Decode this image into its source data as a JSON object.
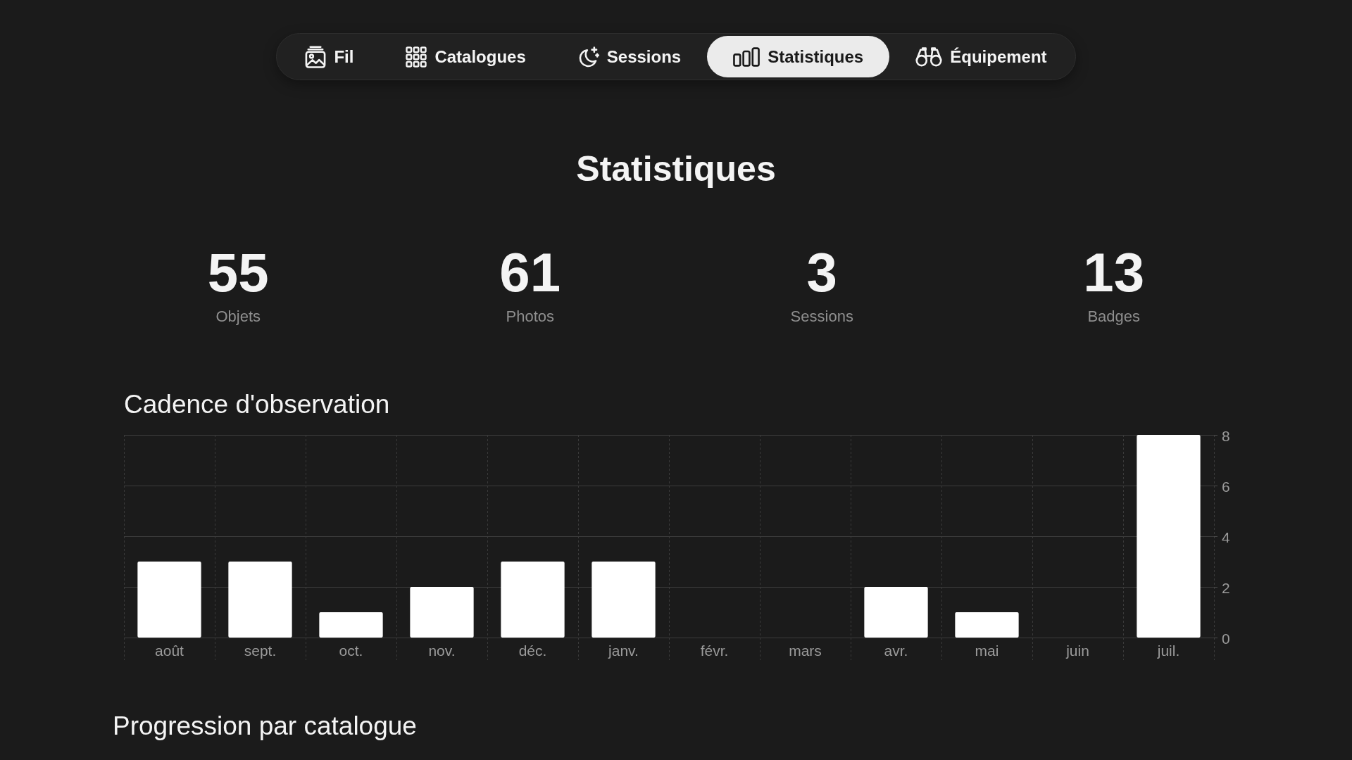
{
  "tabs": [
    {
      "label": "Fil",
      "selected": false
    },
    {
      "label": "Catalogues",
      "selected": false
    },
    {
      "label": "Sessions",
      "selected": false
    },
    {
      "label": "Statistiques",
      "selected": true
    },
    {
      "label": "Équipement",
      "selected": false
    }
  ],
  "page_title": "Statistiques",
  "stats": [
    {
      "value": "55",
      "label": "Objets"
    },
    {
      "value": "61",
      "label": "Photos"
    },
    {
      "value": "3",
      "label": "Sessions"
    },
    {
      "value": "13",
      "label": "Badges"
    }
  ],
  "cadence": {
    "title": "Cadence d'observation",
    "chart_data": {
      "type": "bar",
      "categories": [
        "août",
        "sept.",
        "oct.",
        "nov.",
        "déc.",
        "janv.",
        "févr.",
        "mars",
        "avr.",
        "mai",
        "juin",
        "juil."
      ],
      "values": [
        3,
        3,
        1,
        2,
        3,
        3,
        0,
        0,
        2,
        1,
        0,
        8
      ],
      "ylim": [
        0,
        8
      ],
      "yticks": [
        0,
        2,
        4,
        6,
        8
      ],
      "grid": true
    }
  },
  "progression": {
    "title": "Progression par catalogue"
  }
}
